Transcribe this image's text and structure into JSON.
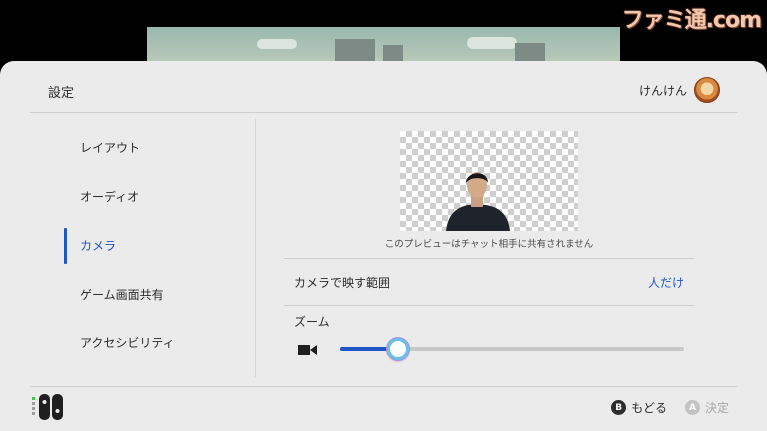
{
  "watermark": "ファミ通.com",
  "header": {
    "title": "設定",
    "user_name": "けんけん"
  },
  "sidebar": {
    "items": [
      {
        "label": "レイアウト",
        "active": false
      },
      {
        "label": "オーディオ",
        "active": false
      },
      {
        "label": "カメラ",
        "active": true
      },
      {
        "label": "ゲーム画面共有",
        "active": false
      },
      {
        "label": "アクセシビリティ",
        "active": false
      }
    ]
  },
  "preview": {
    "note": "このプレビューはチャット相手に共有されません"
  },
  "settings": {
    "camera_range": {
      "label": "カメラで映す範囲",
      "value": "人だけ"
    },
    "zoom": {
      "label": "ズーム",
      "level": 0.17
    }
  },
  "footer": {
    "back": {
      "glyph": "B",
      "label": "もどる"
    },
    "confirm": {
      "glyph": "A",
      "label": "決定"
    }
  },
  "colors": {
    "accent": "#1e56c8",
    "panel_bg": "#ebebeb",
    "text": "#2d2d2d",
    "disabled": "#a8a8a8"
  }
}
